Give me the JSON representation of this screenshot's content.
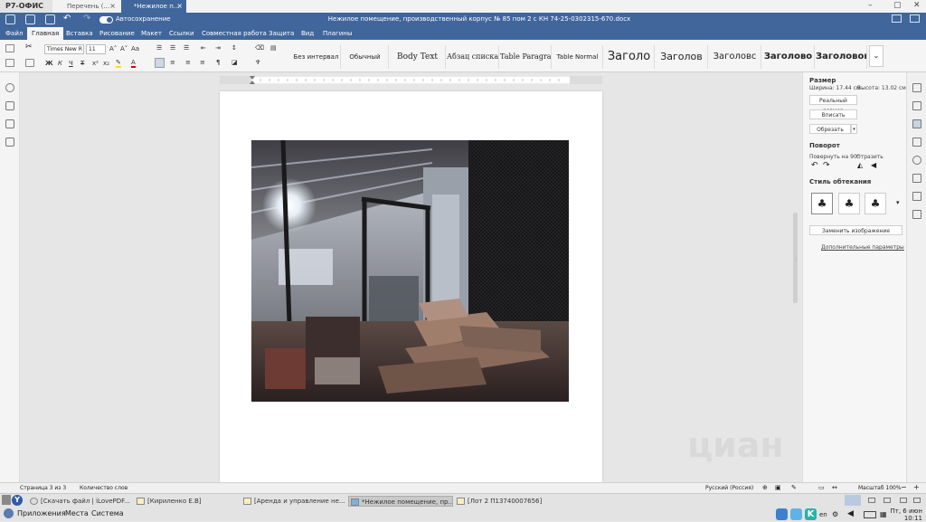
{
  "app": {
    "brand": "Р7-ОФИС",
    "tabs": [
      {
        "label": "Перечень (...",
        "active": false
      },
      {
        "label": "*Нежилое п...",
        "active": true
      }
    ],
    "autosave_label": "Автосохранение",
    "document_title": "Нежилое помещение, производственный корпус № 85 пом 2 с КН 74-25-0302315-670.docx"
  },
  "menu": [
    "Файл",
    "Главная",
    "Вставка",
    "Рисование",
    "Макет",
    "Ссылки",
    "Совместная работа",
    "Защита",
    "Вид",
    "Плагины"
  ],
  "menu_active": "Главная",
  "ribbon": {
    "font_name": "Times New R",
    "font_size": "11",
    "styles": [
      "Без интервал",
      "Обычный",
      "Body Text",
      "Абзац списка",
      "Table Paragra",
      "Table Normal",
      "Заголо",
      "Заголов",
      "Заголовс",
      "Заголово",
      "Заголовок"
    ]
  },
  "right_panel": {
    "size_heading": "Размер",
    "width_text": "Ширина: 17.44 см",
    "height_text": "Высота: 13.02 см",
    "actual_size_button": "Реальный размер",
    "fit_button": "Вписать",
    "crop_button": "Обрезать",
    "rotation_heading": "Поворот",
    "rotate_label": "Повернуть на 90°",
    "flip_label": "Отразить",
    "wrap_heading": "Стиль обтекания",
    "replace_image": "Заменить изображение",
    "advanced": "Дополнительные параметры"
  },
  "status": {
    "page": "Страница 3 из 3",
    "word_count": "Количество слов",
    "language": "Русский (Россия)",
    "zoom": "Масштаб 100%"
  },
  "taskbar": {
    "tasks": [
      {
        "label": "[Скачать файл | iLovePDF...",
        "active": false
      },
      {
        "label": "[Кириленко Е.В]",
        "active": false
      },
      {
        "label": "[Аренда и управление не...",
        "active": false
      },
      {
        "label": "*Нежилое помещение, пр...",
        "active": true
      },
      {
        "label": "[Лот 2 П13740007656]",
        "active": false
      }
    ],
    "menu": [
      "Приложения",
      "Места",
      "Система"
    ],
    "keyboard_layout": "en",
    "clock_date": "Пт, 6 июн",
    "clock_time": "10:11"
  },
  "watermark": "циан",
  "colors": {
    "accent": "#40669c",
    "ribbon_bg": "#f5f5f5",
    "page_bg": "#ffffff"
  },
  "icons": [
    "save-icon",
    "print-icon",
    "undo-icon",
    "redo-icon",
    "search-icon",
    "comment-icon",
    "heading-icon",
    "lock-icon",
    "gear-icon",
    "rotate-left-icon",
    "rotate-right-icon",
    "flip-horizontal-icon",
    "flip-vertical-icon"
  ]
}
